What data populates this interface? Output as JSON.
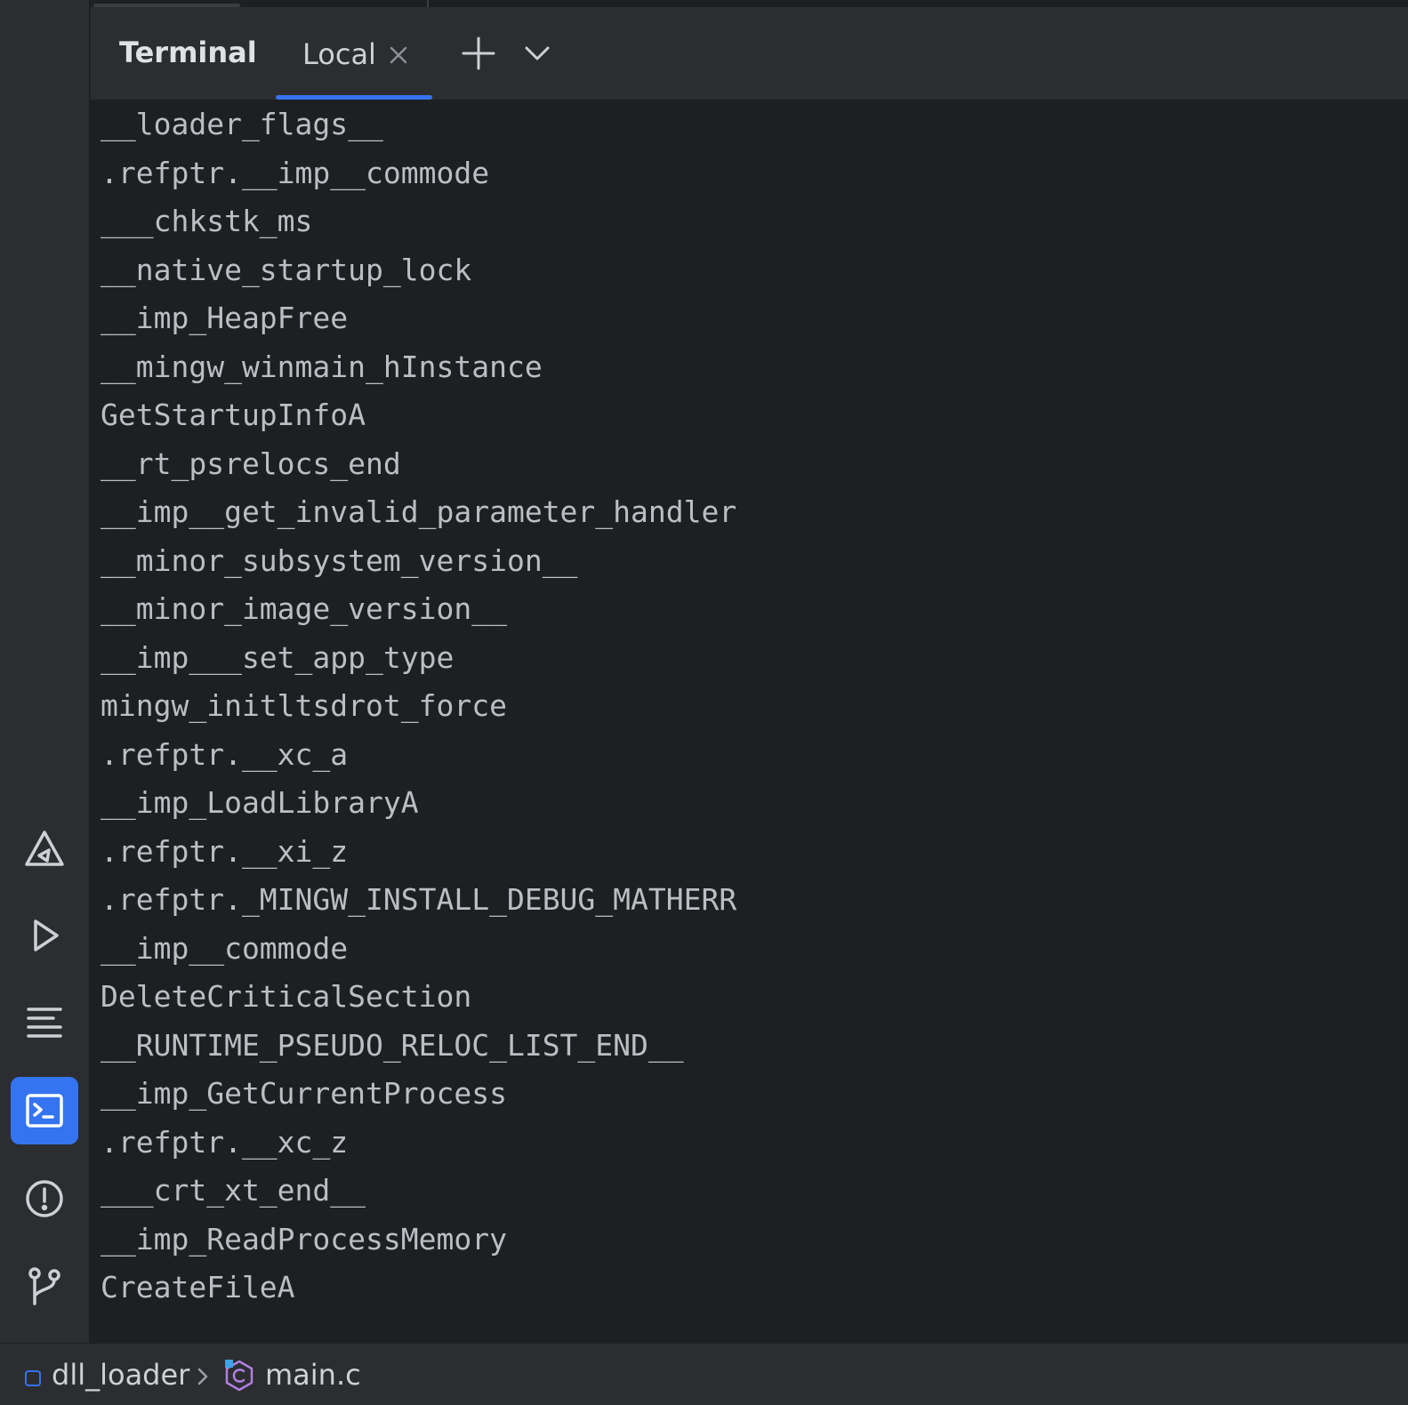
{
  "tool_window": {
    "title": "Terminal",
    "tab_label": "Local"
  },
  "terminal": {
    "lines": [
      "__loader_flags__",
      ".refptr.__imp__commode",
      "___chkstk_ms",
      "__native_startup_lock",
      "__imp_HeapFree",
      "__mingw_winmain_hInstance",
      "GetStartupInfoA",
      "__rt_psrelocs_end",
      "__imp__get_invalid_parameter_handler",
      "__minor_subsystem_version__",
      "__minor_image_version__",
      "__imp___set_app_type",
      "mingw_initltsdrot_force",
      ".refptr.__xc_a",
      "__imp_LoadLibraryA",
      ".refptr.__xi_z",
      ".refptr._MINGW_INSTALL_DEBUG_MATHERR",
      "__imp__commode",
      "DeleteCriticalSection",
      "__RUNTIME_PSEUDO_RELOC_LIST_END__",
      "__imp_GetCurrentProcess",
      ".refptr.__xc_z",
      "___crt_xt_end__",
      "__imp_ReadProcessMemory",
      "CreateFileA"
    ]
  },
  "status_bar": {
    "project": "dll_loader",
    "file": "main.c"
  },
  "colors": {
    "accent": "#3574f0",
    "panel_bg": "#2b2d30",
    "terminal_bg": "#1e1f22",
    "text": "#bcbec4"
  }
}
